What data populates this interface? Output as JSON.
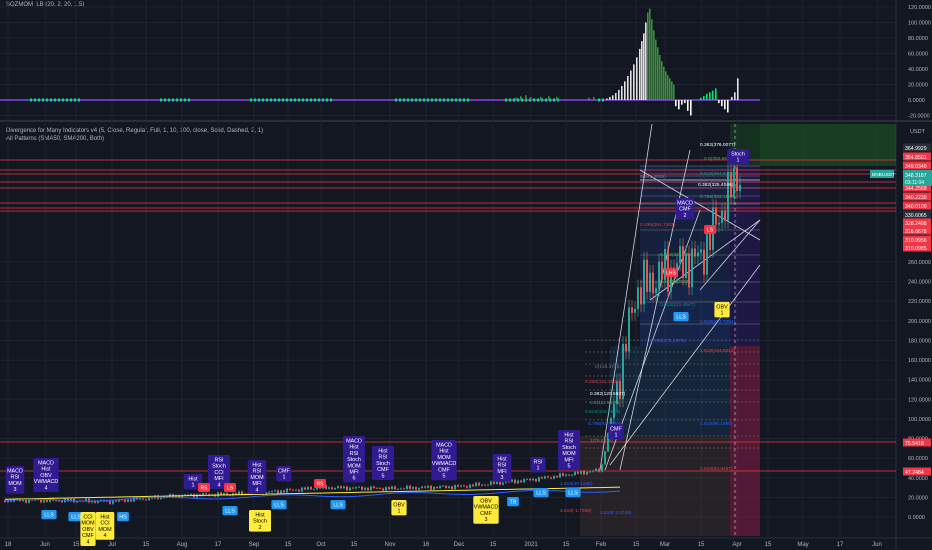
{
  "osc": {
    "title": "SQZMOM_LB (20, 2, 20, 1.5)",
    "ticks": [
      "120.0000",
      "100.0000",
      "80.0000",
      "60.0000",
      "40.0000",
      "20.0000",
      "0.0000",
      "-20.0000"
    ]
  },
  "main": {
    "title1": "Divergence for Many Indicators v4 (5, Close, Regular, Full, 1, 10, 100, close, Solid, Dashed, 2, 1)",
    "title2": "All Patterns (SMA50, SMA200, Both)",
    "currency": "USDT",
    "symbol": "BNBUSDT",
    "last_price": "348.3187",
    "countdown": "03:11:04",
    "price_ticks": [
      "260.0000",
      "240.0000",
      "220.0000",
      "200.0000",
      "180.0000",
      "160.0000",
      "140.0000",
      "120.0000",
      "100.0000",
      "80.0000",
      "60.0000",
      "40.0000",
      "20.0000",
      "0.0000"
    ],
    "price_badges": [
      {
        "text": "364.9929",
        "color": "#2a2e39"
      },
      {
        "text": "354.8501",
        "color": "#f23645"
      },
      {
        "text": "349.0349",
        "color": "#f23645"
      },
      {
        "text": "344.2568",
        "color": "#f23645"
      },
      {
        "text": "340.2230",
        "color": "#f23645"
      },
      {
        "text": "340.0100",
        "color": "#f23645"
      },
      {
        "text": "330.6065",
        "color": "#2a2e39"
      },
      {
        "text": "328.2498",
        "color": "#f23645"
      },
      {
        "text": "316.6678",
        "color": "#f23645"
      },
      {
        "text": "310.9956",
        "color": "#f23645"
      },
      {
        "text": "310.0985",
        "color": "#f23645"
      },
      {
        "text": "75.5418",
        "color": "#f23645"
      },
      {
        "text": "47.2484",
        "color": "#f23645"
      }
    ],
    "fib_upper": [
      {
        "text": "0.382(376.0077)",
        "color": "#ffffff"
      },
      {
        "text": "0.5(350.551)",
        "color": "#4caf50"
      },
      {
        "text": "0.618(334.6766)",
        "color": "#009688"
      },
      {
        "text": "0.382(325.4046)",
        "color": "#ffffff"
      },
      {
        "text": "0.786(323.1544)",
        "color": "#4caf50"
      },
      {
        "text": "0(341.2936)",
        "color": "#787b86"
      },
      {
        "text": "0.236(291.7102)",
        "color": "#f23645"
      },
      {
        "text": "0.382(261.0424)",
        "color": "#4caf50"
      },
      {
        "text": "0.5(236.2533)",
        "color": "#4caf50"
      },
      {
        "text": "0.618(211.4647)",
        "color": "#009688"
      },
      {
        "text": "1.618(201.7284)",
        "color": "#2962ff"
      },
      {
        "text": "0.786(176.1579)",
        "color": "#2962ff"
      },
      {
        "text": "2.618(164.8012)",
        "color": "#f23645"
      }
    ],
    "fib_lower": [
      {
        "text": "0(148.3745)",
        "color": "#787b86"
      },
      {
        "text": "0.236(131.1806)",
        "color": "#f23645"
      },
      {
        "text": "0.382(120.5537)",
        "color": "#ffffff"
      },
      {
        "text": "0.5(111.9596)",
        "color": "#4caf50"
      },
      {
        "text": "0.618(103.5656)",
        "color": "#009688"
      },
      {
        "text": "0.786(91.5979)",
        "color": "#2962ff"
      },
      {
        "text": "1.618(96.1969)",
        "color": "#2962ff"
      },
      {
        "text": "1(75.4818)",
        "color": "#787b86"
      },
      {
        "text": "2.618(64.9467)",
        "color": "#f23645"
      },
      {
        "text": "1.618(20.1245)",
        "color": "#2962ff"
      },
      {
        "text": "2.618(-1.7206)",
        "color": "#f23645"
      },
      {
        "text": "1.618(-3.3748)",
        "color": "#2962ff"
      }
    ],
    "x_ticks": [
      {
        "text": "18",
        "x": 8
      },
      {
        "text": "Jun",
        "x": 45
      },
      {
        "text": "15",
        "x": 76
      },
      {
        "text": "Jul",
        "x": 112
      },
      {
        "text": "15",
        "x": 146
      },
      {
        "text": "Aug",
        "x": 182
      },
      {
        "text": "17",
        "x": 218
      },
      {
        "text": "Sep",
        "x": 254
      },
      {
        "text": "15",
        "x": 288
      },
      {
        "text": "Oct",
        "x": 321
      },
      {
        "text": "15",
        "x": 354
      },
      {
        "text": "Nov",
        "x": 390
      },
      {
        "text": "16",
        "x": 426
      },
      {
        "text": "Dec",
        "x": 459
      },
      {
        "text": "15",
        "x": 493
      },
      {
        "text": "2021",
        "x": 531
      },
      {
        "text": "15",
        "x": 566
      },
      {
        "text": "Feb",
        "x": 601
      },
      {
        "text": "15",
        "x": 636
      },
      {
        "text": "Mar",
        "x": 665
      },
      {
        "text": "15",
        "x": 701
      },
      {
        "text": "Apr",
        "x": 737
      },
      {
        "text": "15",
        "x": 768
      },
      {
        "text": "May",
        "x": 803
      },
      {
        "text": "17",
        "x": 840
      },
      {
        "text": "Jun",
        "x": 877
      }
    ],
    "labels": [
      {
        "text": "MACD\nRSI\nMOM\n3",
        "x": 15,
        "y": 466,
        "kind": "purple"
      },
      {
        "text": "MACD\nHist\nOBV\nVWMACD\n4",
        "x": 46,
        "y": 458,
        "kind": "purple"
      },
      {
        "text": "LLS",
        "x": 49,
        "y": 510,
        "kind": "blue"
      },
      {
        "text": "LLS",
        "x": 76,
        "y": 512,
        "kind": "blue"
      },
      {
        "text": "CCI\nMOM\nOBV\nCMF\n4",
        "x": 88,
        "y": 512,
        "kind": "yellow"
      },
      {
        "text": "Hist\nCCI\nMOM\n4",
        "x": 105,
        "y": 512,
        "kind": "yellow"
      },
      {
        "text": "HS",
        "x": 123,
        "y": 512,
        "kind": "blue"
      },
      {
        "text": "Hist\n1",
        "x": 193,
        "y": 474,
        "kind": "purple"
      },
      {
        "text": "RSI\nStoch\nCCI\nMFI\n4",
        "x": 219,
        "y": 455,
        "kind": "purple"
      },
      {
        "text": "Hist\nStoch\n2",
        "x": 260,
        "y": 510,
        "kind": "yellow"
      },
      {
        "text": "LLS",
        "x": 230,
        "y": 506,
        "kind": "blue"
      },
      {
        "text": "Hist\nRSI\nMOM\nMFI\n4",
        "x": 257,
        "y": 460,
        "kind": "purple"
      },
      {
        "text": "CMF\n1",
        "x": 284,
        "y": 466,
        "kind": "purple"
      },
      {
        "text": "LLS",
        "x": 279,
        "y": 500,
        "kind": "blue"
      },
      {
        "text": "MACD\nHist\nRSI\nStoch\nMOM\nMFI\n6",
        "x": 354,
        "y": 436,
        "kind": "purple"
      },
      {
        "text": "Hist\nRSI\nStoch\nCMF\n5",
        "x": 383,
        "y": 446,
        "kind": "purple"
      },
      {
        "text": "LLS",
        "x": 338,
        "y": 500,
        "kind": "blue"
      },
      {
        "text": "OBV\n1",
        "x": 399,
        "y": 500,
        "kind": "yellow"
      },
      {
        "text": "MACD\nHist\nMOM\nVWMACD\nCMF\n5",
        "x": 444,
        "y": 440,
        "kind": "purple"
      },
      {
        "text": "Hist\nRSI\nMFI\n3",
        "x": 502,
        "y": 454,
        "kind": "purple"
      },
      {
        "text": "OBV\nVWMACD\nCMF\n3",
        "x": 486,
        "y": 496,
        "kind": "yellow"
      },
      {
        "text": "TB",
        "x": 513,
        "y": 497,
        "kind": "blue"
      },
      {
        "text": "RSI\n1",
        "x": 538,
        "y": 457,
        "kind": "purple"
      },
      {
        "text": "LLS",
        "x": 541,
        "y": 488,
        "kind": "blue"
      },
      {
        "text": "Hist\nRSI\nStoch\nMOM\nMFI\n5",
        "x": 569,
        "y": 430,
        "kind": "purple"
      },
      {
        "text": "LLS",
        "x": 573,
        "y": 488,
        "kind": "blue"
      },
      {
        "text": "CMF\n1",
        "x": 616,
        "y": 424,
        "kind": "purple"
      },
      {
        "text": "MACD\nCMF\n2",
        "x": 685,
        "y": 198,
        "kind": "purple"
      },
      {
        "text": "Stoch\n1",
        "x": 738,
        "y": 149,
        "kind": "purple"
      },
      {
        "text": "OBV\n1",
        "x": 722,
        "y": 302,
        "kind": "yellow"
      },
      {
        "text": "LLS",
        "x": 681,
        "y": 312,
        "kind": "blue"
      }
    ],
    "red_tags": [
      {
        "text": "RS",
        "x": 204,
        "y": 483
      },
      {
        "text": "LS",
        "x": 230,
        "y": 483
      },
      {
        "text": "RS",
        "x": 320,
        "y": 479
      },
      {
        "text": "LHS",
        "x": 671,
        "y": 268
      },
      {
        "text": "LS",
        "x": 710,
        "y": 225
      }
    ]
  },
  "colors": {
    "background": "#131722",
    "grid": "#1e222d",
    "up": "#26a69a",
    "down": "#ef5350",
    "osc_lime": "#00e676",
    "osc_green": "#388e3c",
    "osc_white": "#e0e0e0",
    "osc_baseline": "#673ab7",
    "label_purple": "#311b92",
    "label_yellow": "#ffeb3b",
    "label_blue": "#2196f3"
  },
  "chart_data": {
    "type": "line",
    "symbol": "BNBUSDT",
    "y_axis_range": [
      -10,
      380
    ],
    "approx_close": [
      [
        "Jun",
        17
      ],
      [
        "Jul",
        16
      ],
      [
        "Aug",
        22
      ],
      [
        "Sep",
        24
      ],
      [
        "Oct",
        30
      ],
      [
        "Nov",
        29
      ],
      [
        "Dec",
        31
      ],
      [
        "2021",
        38
      ],
      [
        "Feb",
        48
      ],
      [
        "15",
        230
      ],
      [
        "Mar",
        250
      ],
      [
        "15",
        265
      ],
      [
        "Apr",
        348
      ]
    ]
  }
}
